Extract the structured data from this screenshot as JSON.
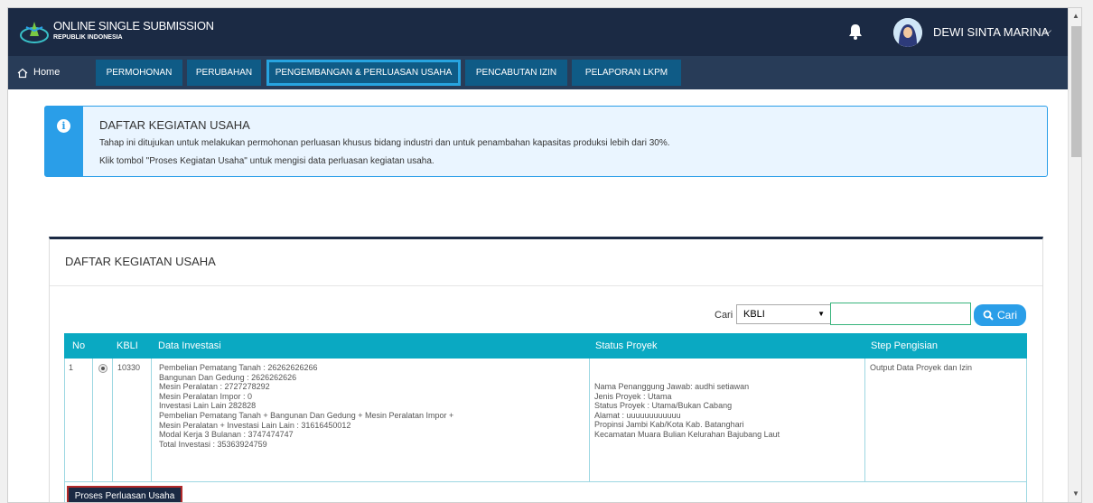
{
  "header": {
    "brand_title": "ONLINE SINGLE SUBMISSION",
    "brand_subtitle": "REPUBLIK INDONESIA",
    "user_name": "DEWI SINTA MARINA",
    "chevron": "⌵",
    "icons": [
      "oss-logo-icon",
      "bell-icon",
      "avatar",
      "chevron-down-icon"
    ]
  },
  "nav": {
    "home": "Home",
    "items": [
      "PERMOHONAN",
      "PERUBAHAN",
      "PENGEMBANGAN & PERLUASAN USAHA",
      "PENCABUTAN IZIN",
      "PELAPORAN LKPM"
    ],
    "active_index": 2
  },
  "info": {
    "icon": "i",
    "title": "DAFTAR KEGIATAN USAHA",
    "line1": "Tahap ini ditujukan untuk melakukan permohonan perluasan khusus bidang industri dan untuk penambahan kapasitas produksi lebih dari 30%.",
    "line2": "Klik tombol \"Proses Kegiatan Usaha\" untuk mengisi data perluasan kegiatan usaha."
  },
  "panel": {
    "title": "DAFTAR KEGIATAN USAHA",
    "search": {
      "label": "Cari",
      "selected": "KBLI",
      "input_value": "",
      "button": "Cari"
    },
    "columns": [
      "No",
      "KBLI",
      "Data Investasi",
      "Status Proyek",
      "Step Pengisian"
    ],
    "rows": [
      {
        "no": "1",
        "kbli": "10330",
        "selected": true,
        "investasi": [
          "Pembelian Pematang Tanah : 26262626266",
          "Bangunan Dan Gedung : 2626262626",
          "Mesin Peralatan : 2727278292",
          "Mesin Peralatan Impor : 0",
          "Investasi Lain Lain 282828",
          "Pembelian Pematang Tanah + Bangunan Dan Gedung + Mesin Peralatan Impor +",
          "Mesin Peralatan + Investasi Lain Lain : 31616450012",
          "Modal Kerja 3 Bulanan : 3747474747",
          "Total Investasi : 35363924759"
        ],
        "status": [
          "Nama Penanggung Jawab: audhi setiawan",
          "Jenis Proyek : Utama",
          "Status Proyek : Utama/Bukan Cabang",
          "Alamat : uuuuuuuuuuuu",
          "Propinsi Jambi Kab/Kota Kab. Batanghari",
          "Kecamatan Muara Bulian Kelurahan Bajubang Laut"
        ],
        "step": "Output Data Proyek dan Izin"
      }
    ],
    "proses_button": "Proses Perluasan Usaha"
  },
  "colors": {
    "topbar": "#1b2a44",
    "nav_item": "#0f5b86",
    "accent": "#2a9ee8",
    "table_header": "#0aa9c2"
  }
}
